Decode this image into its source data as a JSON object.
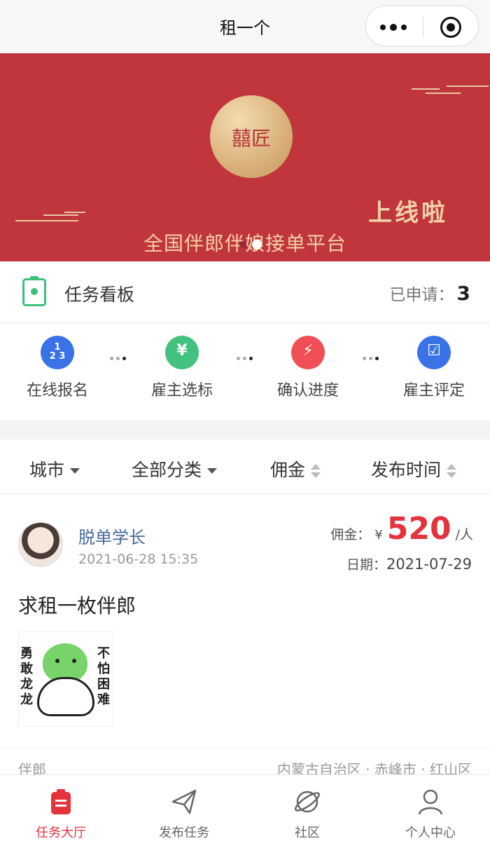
{
  "navbar": {
    "title": "租一个"
  },
  "banner": {
    "seal_text": "囍匠",
    "slogan": "上线啦",
    "subtitle": "全国伴郎伴娘接单平台",
    "page_count": 2,
    "active_page": 2
  },
  "board": {
    "label": "任务看板",
    "applied_label": "已申请：",
    "applied_count": "3"
  },
  "steps": [
    {
      "label": "在线报名",
      "icon": "number-grid-icon",
      "color": "#3a73e8"
    },
    {
      "label": "雇主选标",
      "icon": "employer-yen-icon",
      "color": "#42c27e"
    },
    {
      "label": "确认进度",
      "icon": "timer-bolt-icon",
      "color": "#ef4f55"
    },
    {
      "label": "雇主评定",
      "icon": "checklist-icon",
      "color": "#3a73e8"
    }
  ],
  "filters": [
    {
      "label": "城市",
      "kind": "dropdown"
    },
    {
      "label": "全部分类",
      "kind": "dropdown"
    },
    {
      "label": "佣金",
      "kind": "sort"
    },
    {
      "label": "发布时间",
      "kind": "sort"
    }
  ],
  "task": {
    "user_name": "脱单学长",
    "post_time": "2021-06-28 15:35",
    "fee_label": "佣金：",
    "currency": "¥",
    "fee_amount": "520",
    "fee_unit": "/人",
    "date_label": "日期：",
    "date_value": "2021-07-29",
    "title": "求租一枚伴郎",
    "sticker_left": "勇敢龙龙",
    "sticker_right": "不怕困难",
    "category": "伴郎",
    "location": "内蒙古自治区 · 赤峰市 · 红山区"
  },
  "tabbar": [
    {
      "label": "任务大厅",
      "icon": "clipboard-icon",
      "active": true
    },
    {
      "label": "发布任务",
      "icon": "paper-plane-icon",
      "active": false
    },
    {
      "label": "社区",
      "icon": "planet-icon",
      "active": false
    },
    {
      "label": "个人中心",
      "icon": "user-icon",
      "active": false
    }
  ],
  "colors": {
    "brand_red": "#c1353d",
    "accent_red": "#e5323c",
    "link_blue": "#456a99"
  }
}
